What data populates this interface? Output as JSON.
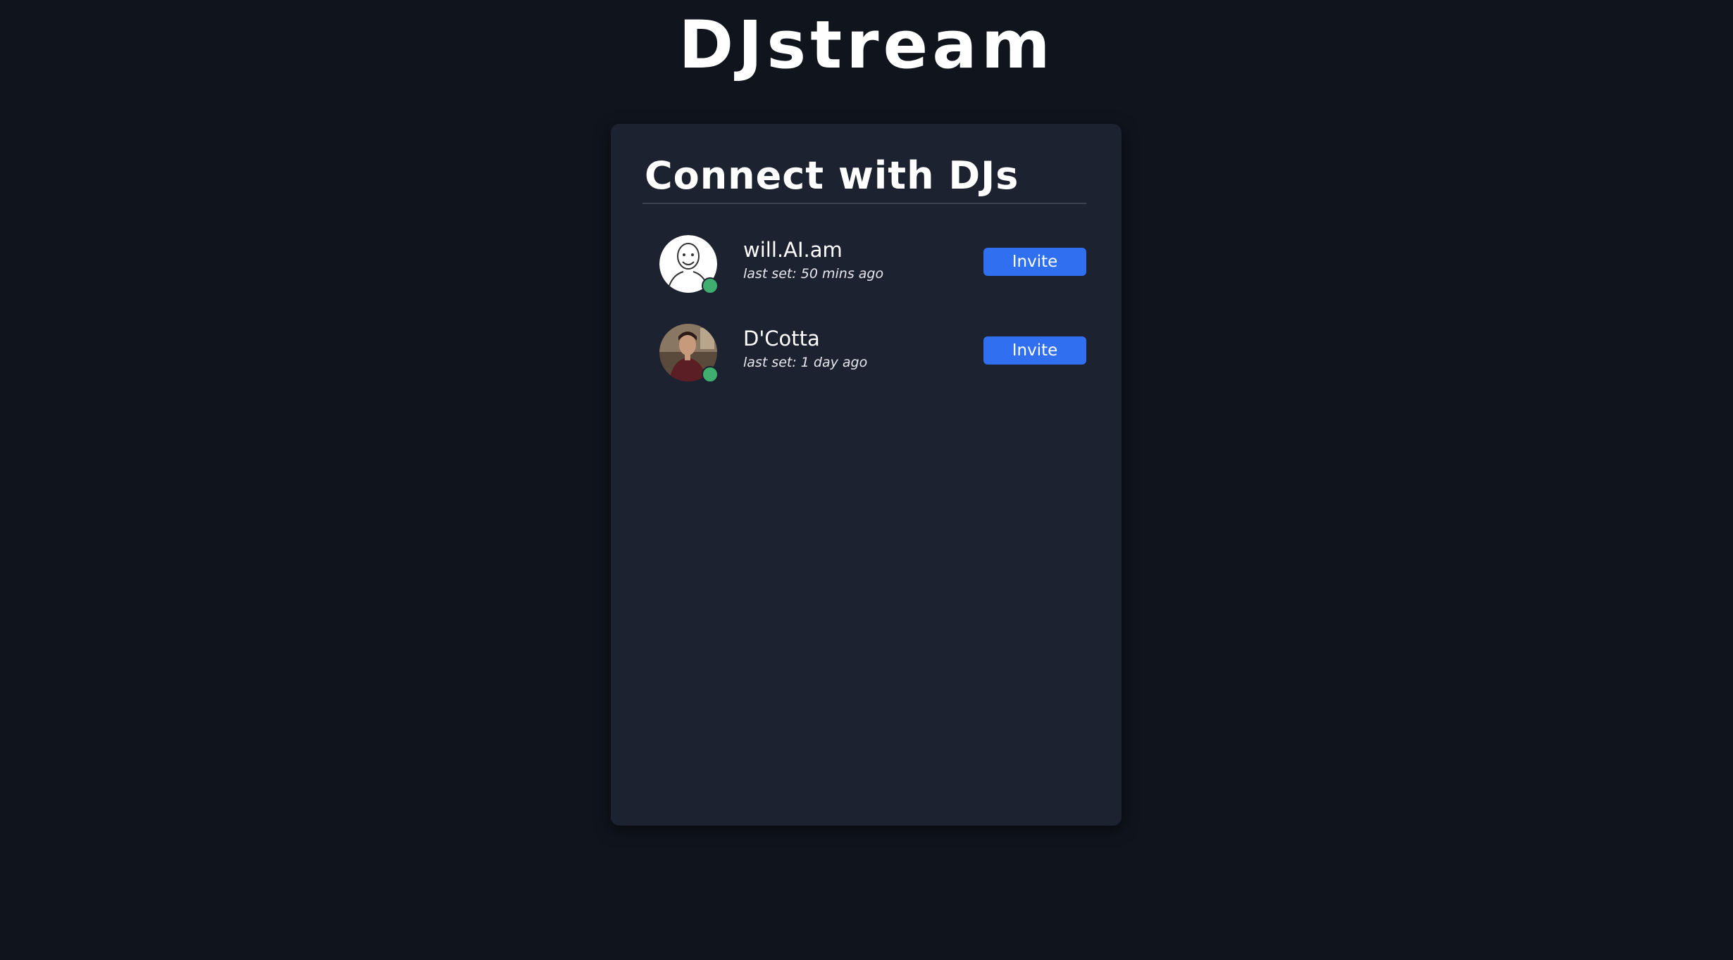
{
  "app": {
    "logo": "DJstream"
  },
  "panel": {
    "title": "Connect with DJs"
  },
  "djs": [
    {
      "name": "will.AI.am",
      "last_set": "last set: 50 mins ago",
      "invite_label": "Invite",
      "online": true,
      "avatar": "cartoon-face-avatar"
    },
    {
      "name": "D'Cotta",
      "last_set": "last set: 1 day ago",
      "invite_label": "Invite",
      "online": true,
      "avatar": "photo-avatar"
    }
  ],
  "colors": {
    "background": "#10141d",
    "card": "#1d2230",
    "accent": "#2f6ff0",
    "online": "#3fae6e"
  }
}
